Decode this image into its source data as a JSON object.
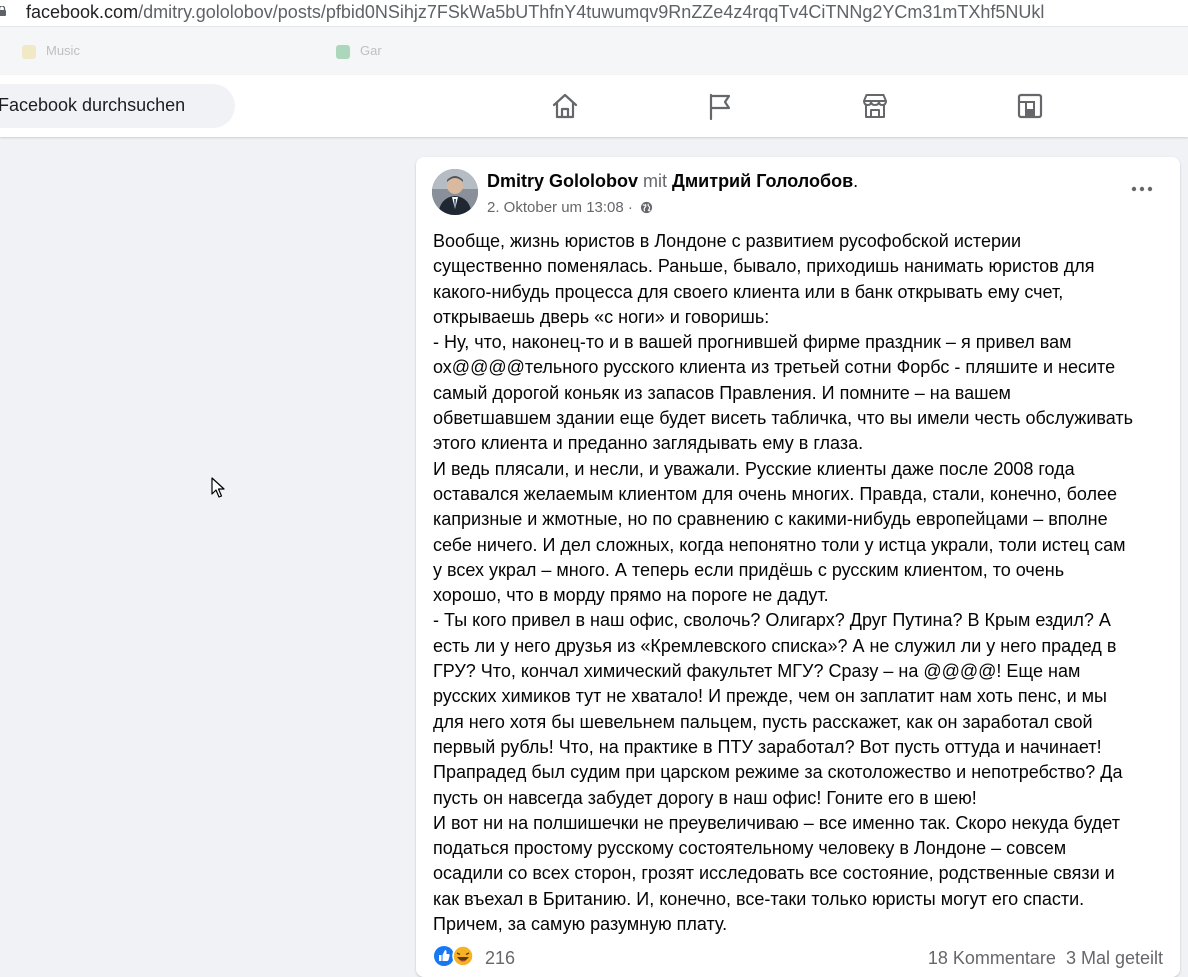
{
  "browser": {
    "url_domain": "facebook.com",
    "url_path": "/dmitry.gololobov/posts/pfbid0NSihjz7FSkWa5bUThfnY4tuwumqv9RnZZe4z4rqqTv4CiTNNg2YCm31mTXhf5NUkl",
    "bookmarks": [
      "Music",
      "Gar"
    ]
  },
  "nav": {
    "search_placeholder": "Facebook durchsuchen",
    "icons": [
      "home-icon",
      "pages-flag-icon",
      "marketplace-icon",
      "gaming-icon"
    ]
  },
  "post": {
    "author": "Dmitry Gololobov",
    "with_word": "mit",
    "tagged": "Дмитрий Гололобов",
    "end_dot": ".",
    "timestamp": "2. Oktober um 13:08",
    "separator": "·",
    "privacy_icon": "globe-icon",
    "body": "Вообще, жизнь юристов в Лондоне с развитием русофобской истерии\nсущественно поменялась. Раньше, бывало, приходишь нанимать юристов для\nкакого-нибудь процесса для своего клиента или в банк открывать ему счет,\nоткрываешь дверь «с ноги» и говоришь:\n- Ну, что, наконец-то и в вашей прогнившей фирме праздник – я привел вам\nох@@@@тельного русского клиента из третьей сотни Форбс - пляшите и несите\nсамый дорогой коньяк из запасов Правления. И помните – на вашем\nобветшавшем здании еще будет висеть табличка, что вы имели честь обслуживать\nэтого клиента и преданно заглядывать ему в глаза.\nИ ведь плясали, и несли, и уважали. Русские клиенты даже после 2008 года\nоставался желаемым клиентом для очень многих. Правда, стали, конечно, более\nкапризные и жмотные, но по сравнению с какими-нибудь европейцами – вполне\nсебе ничего. И дел сложных, когда непонятно толи у истца украли, толи истец сам\nу всех украл – много. А теперь если придёшь с русским клиентом, то очень\nхорошо, что в морду прямо на пороге не дадут.\n- Ты кого привел в наш офис, сволочь? Олигарх? Друг Путина? В Крым ездил? А\nесть ли у него друзья из «Кремлевского списка»? А не служил ли у него прадед в\nГРУ? Что, кончал химический факультет МГУ? Сразу – на @@@@! Еще нам\nрусских химиков тут не хватало! И прежде, чем он заплатит нам хоть пенс, и мы\nдля него хотя бы шевельнем пальцем, пусть расскажет, как он заработал свой\nпервый рубль! Что, на практике в ПТУ заработал? Вот пусть оттуда и начинает!\nПрапрадед был судим при царском режиме за скотоложество и непотребство? Да\nпусть он навсегда забудет дорогу в наш офис! Гоните его в шею!\nИ вот ни на полшишечки не преувеличиваю – все именно так. Скоро некуда будет\nподаться простому русскому состоятельному человеку в Лондоне – совсем\nосадили со всех сторон, грозят исследовать все состояние, родственные связи и\nкак въехал в Британию. И, конечно, все-таки только юристы могут его спасти.\nПричем, за самую разумную плату.",
    "reaction_count": "216",
    "comments": "18 Kommentare",
    "shares": "3 Mal geteilt",
    "colors": {
      "like": "#1877f2",
      "haha": "#f7b125",
      "text_secondary": "#65676b"
    }
  }
}
